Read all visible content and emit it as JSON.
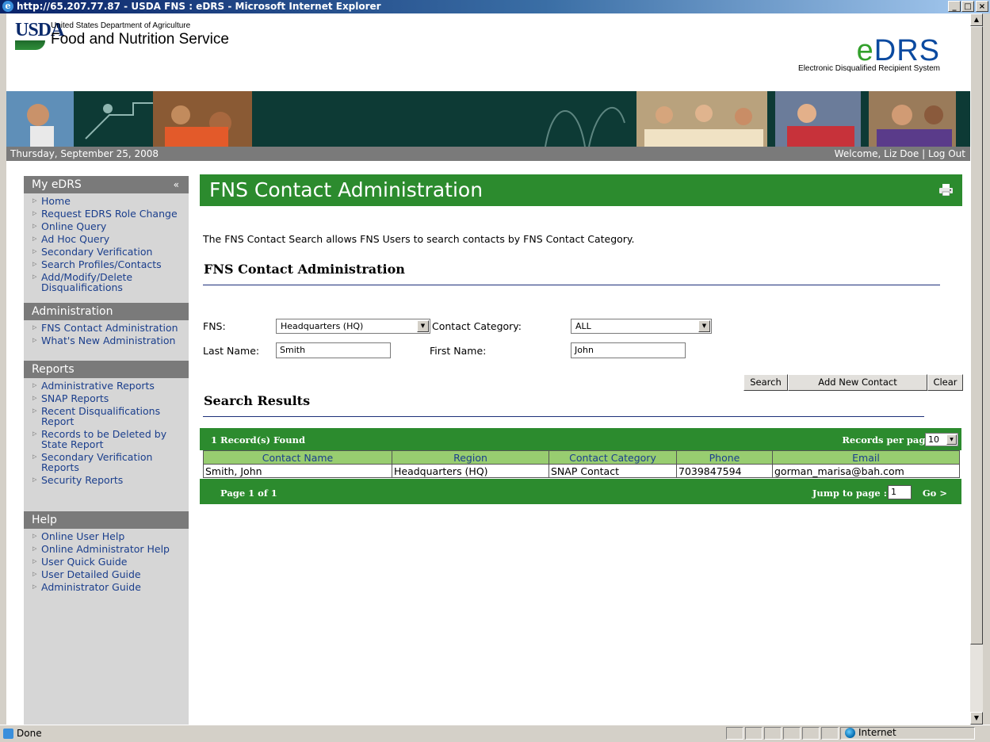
{
  "window": {
    "title": "http://65.207.77.87 - USDA FNS : eDRS - Microsoft Internet Explorer",
    "min": "_",
    "max": "□",
    "close": "×"
  },
  "header": {
    "logo_mark": "USDA",
    "dept": "United States Department of Agriculture",
    "agency": "Food and Nutrition Service",
    "brand_e": "e",
    "brand_rest": "DRS",
    "brand_sub": "Electronic Disqualified Recipient System"
  },
  "datebar": {
    "date": "Thursday, September 25, 2008",
    "welcome": "Welcome, Liz Doe",
    "separator": "|",
    "logout": "Log Out"
  },
  "sidebar": {
    "collapse": "«",
    "sections": [
      {
        "title": "My eDRS",
        "items": [
          "Home",
          "Request EDRS Role Change",
          "Online Query",
          "Ad Hoc Query",
          "Secondary Verification",
          "Search Profiles/Contacts",
          "Add/Modify/Delete Disqualifications"
        ]
      },
      {
        "title": "Administration",
        "items": [
          "FNS Contact Administration",
          "What's New Administration"
        ]
      },
      {
        "title": "Reports",
        "items": [
          "Administrative Reports",
          "SNAP Reports",
          "Recent Disqualifications Report",
          "Records to be Deleted by State Report",
          "Secondary Verification Reports",
          "Security Reports"
        ]
      },
      {
        "title": "Help",
        "items": [
          "Online User Help",
          "Online Administrator Help",
          "User Quick Guide",
          "User Detailed Guide",
          "Administrator Guide"
        ]
      }
    ]
  },
  "main": {
    "page_title": "FNS Contact Administration",
    "intro": "The FNS Contact Search allows FNS Users to search contacts by FNS Contact Category.",
    "section_title": "FNS Contact Administration",
    "form": {
      "fns_label": "FNS:",
      "fns_value": "Headquarters (HQ)",
      "category_label": "Contact Category:",
      "category_value": "ALL",
      "last_label": "Last Name:",
      "last_value": "Smith",
      "first_label": "First Name:",
      "first_value": "John"
    },
    "buttons": {
      "search": "Search",
      "add": "Add New Contact",
      "clear": "Clear"
    },
    "results_title": "Search Results"
  },
  "results": {
    "count": "1 Record(s) Found",
    "rpp_label": "Records per page :",
    "rpp_value": "10",
    "columns": [
      "Contact Name",
      "Region",
      "Contact Category",
      "Phone",
      "Email"
    ],
    "rows": [
      [
        "Smith, John",
        "Headquarters (HQ)",
        "SNAP Contact",
        "7039847594",
        "gorman_marisa@bah.com"
      ]
    ],
    "page": "Page 1 of 1",
    "jump_label": "Jump to page :",
    "jump_value": "1",
    "go": "Go >"
  },
  "status": {
    "text": "Done",
    "zone": "Internet"
  },
  "colors": {
    "green": "#2c8b2e",
    "grid_header": "#98cd70",
    "link": "#1a3e8c"
  }
}
